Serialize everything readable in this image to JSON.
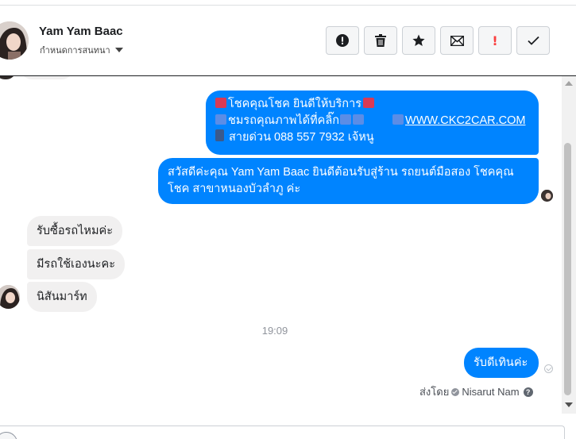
{
  "header": {
    "contact_name": "Yam Yam Baac",
    "subtitle": "กำหนดการสนทนา"
  },
  "toolbar": {
    "buttons": [
      {
        "name": "report",
        "icon": "alert-circle-icon"
      },
      {
        "name": "delete",
        "icon": "trash-icon"
      },
      {
        "name": "star",
        "icon": "star-icon"
      },
      {
        "name": "mark-unread",
        "icon": "envelope-icon"
      },
      {
        "name": "important",
        "icon": "exclamation-icon",
        "label": "!"
      },
      {
        "name": "done",
        "icon": "checkmark-icon"
      }
    ]
  },
  "conversation": {
    "outgoing_1": {
      "line1": "โชคคุณโชค ยินดีให้บริการ",
      "line2_text": "ชมรถคุณภาพได้ที่คลิ๊ก",
      "line2_link": "WWW.CKC2CAR.COM",
      "line3": "สายด่วน 088 557 7932 เจ้หนู"
    },
    "outgoing_2": "สวัสดีค่ะคุณ Yam Yam Baac ยินดีต้อนรับสู่ร้าน รถยนต์มือสอง โชคคุณโชค สาขาหนองบัวลำภู ค่ะ",
    "incoming": [
      "รับซื้อรถไหมค่ะ",
      "มีรถใช้เองนะคะ",
      "นิสันมาร์ท"
    ],
    "timestamp": "19:09",
    "outgoing_3": "รับดีเทินค่ะ",
    "sent_by_prefix": "ส่งโดย",
    "sent_by_name": "Nisarut Nam",
    "help_mark": "?"
  },
  "colors": {
    "outgoing_bubble": "#0084ff",
    "incoming_bubble": "#f1f0f0",
    "important_red": "#fa3e3e"
  }
}
